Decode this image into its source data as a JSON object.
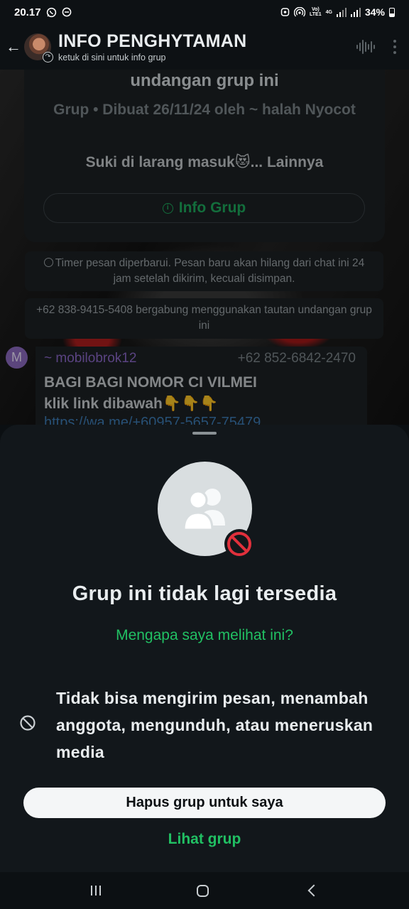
{
  "status_bar": {
    "time": "20.17",
    "battery": "34%",
    "network_label_top": "Vo)",
    "network_label_bottom": "LTE1",
    "network_gen": "4G"
  },
  "header": {
    "title": "INFO PENGHYTAMAN",
    "subtitle": "ketuk di sini untuk info grup"
  },
  "info_card": {
    "invite_line": "undangan grup ini",
    "meta": "Grup • Dibuat 26/11/24 oleh ~ halah Nyocot",
    "description": "Suki di larang masuk😻...",
    "more_label": " Lainnya",
    "button_label": "Info Grup"
  },
  "system_messages": {
    "timer": "Timer pesan diperbarui. Pesan baru akan hilang dari chat ini 24 jam setelah dikirim, kecuali disimpan.",
    "join": "+62 838-9415-5408 bergabung menggunakan tautan undangan grup ini"
  },
  "message": {
    "avatar_letter": "M",
    "sender": "~ mobilobrok12",
    "phone": "+62 852-6842-2470",
    "text_line1": "BAGI BAGI NOMOR CI VILMEI",
    "text_line2": "klik link dibawah",
    "emoji": "👇👇👇",
    "link_partial": "https://wa.me/+60957-5657-75479..."
  },
  "sheet": {
    "title": "Grup ini tidak lagi tersedia",
    "why_link": "Mengapa saya melihat ini?",
    "restriction": "Tidak bisa mengirim pesan, menambah anggota, mengunduh, atau meneruskan media",
    "delete_button": "Hapus grup untuk saya",
    "view_group": "Lihat grup"
  },
  "colors": {
    "accent_green": "#21c063",
    "blocked_red": "#e0303c",
    "sender_purple": "#8b68c8"
  },
  "icons": [
    "whatsapp-icon",
    "dnd-icon",
    "alarm-icon",
    "hotspot-icon",
    "signal-icon",
    "battery-icon",
    "back-arrow-icon",
    "voice-chat-icon",
    "more-menu-icon",
    "info-icon",
    "timer-icon",
    "group-icon",
    "blocked-icon",
    "nav-recents-icon",
    "nav-home-icon",
    "nav-back-icon"
  ]
}
